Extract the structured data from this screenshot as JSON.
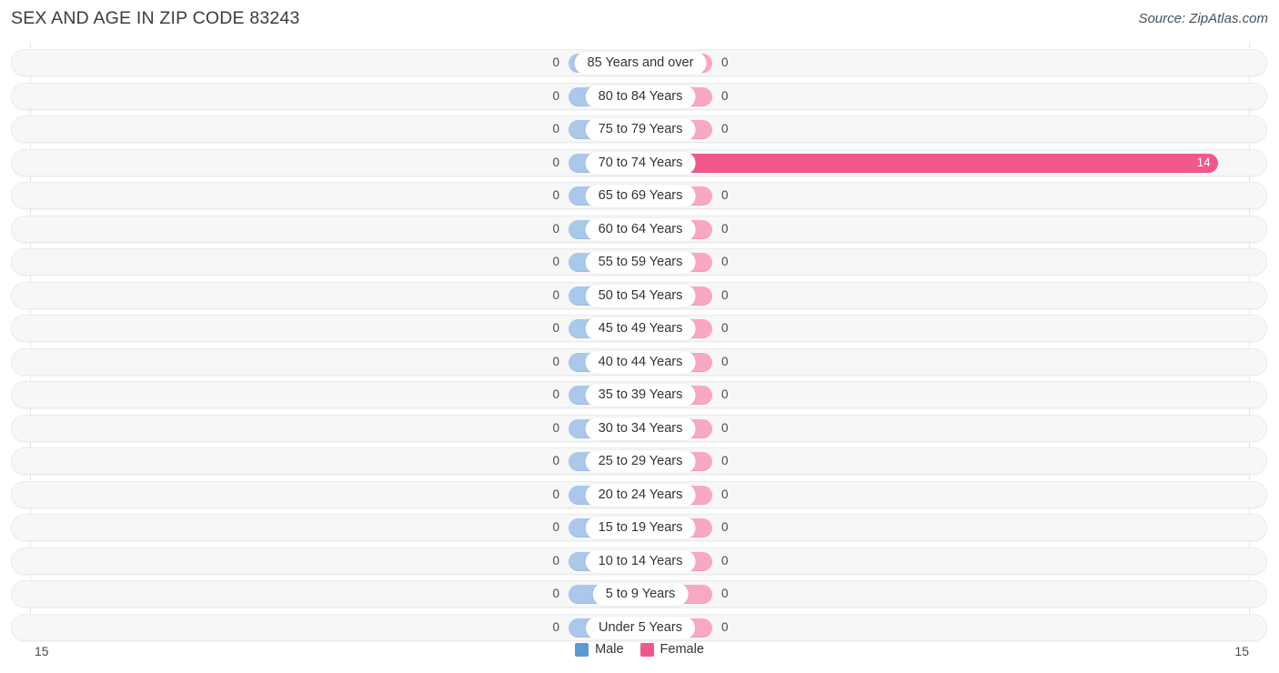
{
  "header": {
    "title": "SEX AND AGE IN ZIP CODE 83243",
    "source": "Source: ZipAtlas.com"
  },
  "legend": {
    "items": [
      {
        "label": "Male",
        "color": "#5b9bd5"
      },
      {
        "label": "Female",
        "color": "#f2578c"
      }
    ]
  },
  "axis": {
    "left_label": "15",
    "right_label": "15"
  },
  "colors": {
    "male_bar": "#a9c8eb",
    "female_bar": "#f9a8c4",
    "male_highlight": "#5b9bd5",
    "female_highlight": "#f2578c",
    "row_background": "#f7f7f7",
    "gridline": "#e6e6e6"
  },
  "chart_data": {
    "type": "bar",
    "title": "SEX AND AGE IN ZIP CODE 83243",
    "subtitle": "Source: ZipAtlas.com",
    "orientation": "horizontal-diverging",
    "xlabel": "",
    "ylabel": "",
    "xlim": [
      15,
      15
    ],
    "grid": true,
    "legend_position": "bottom-center",
    "categories": [
      "85 Years and over",
      "80 to 84 Years",
      "75 to 79 Years",
      "70 to 74 Years",
      "65 to 69 Years",
      "60 to 64 Years",
      "55 to 59 Years",
      "50 to 54 Years",
      "45 to 49 Years",
      "40 to 44 Years",
      "35 to 39 Years",
      "30 to 34 Years",
      "25 to 29 Years",
      "20 to 24 Years",
      "15 to 19 Years",
      "10 to 14 Years",
      "5 to 9 Years",
      "Under 5 Years"
    ],
    "series": [
      {
        "name": "Male",
        "values": [
          0,
          0,
          0,
          0,
          0,
          0,
          0,
          0,
          0,
          0,
          0,
          0,
          0,
          0,
          0,
          0,
          0,
          0
        ]
      },
      {
        "name": "Female",
        "values": [
          0,
          0,
          0,
          14,
          0,
          0,
          0,
          0,
          0,
          0,
          0,
          0,
          0,
          0,
          0,
          0,
          0,
          0
        ]
      }
    ]
  },
  "rows": [
    {
      "label": "85 Years and over",
      "male": "0",
      "female": "0"
    },
    {
      "label": "80 to 84 Years",
      "male": "0",
      "female": "0"
    },
    {
      "label": "75 to 79 Years",
      "male": "0",
      "female": "0"
    },
    {
      "label": "70 to 74 Years",
      "male": "0",
      "female": "14"
    },
    {
      "label": "65 to 69 Years",
      "male": "0",
      "female": "0"
    },
    {
      "label": "60 to 64 Years",
      "male": "0",
      "female": "0"
    },
    {
      "label": "55 to 59 Years",
      "male": "0",
      "female": "0"
    },
    {
      "label": "50 to 54 Years",
      "male": "0",
      "female": "0"
    },
    {
      "label": "45 to 49 Years",
      "male": "0",
      "female": "0"
    },
    {
      "label": "40 to 44 Years",
      "male": "0",
      "female": "0"
    },
    {
      "label": "35 to 39 Years",
      "male": "0",
      "female": "0"
    },
    {
      "label": "30 to 34 Years",
      "male": "0",
      "female": "0"
    },
    {
      "label": "25 to 29 Years",
      "male": "0",
      "female": "0"
    },
    {
      "label": "20 to 24 Years",
      "male": "0",
      "female": "0"
    },
    {
      "label": "15 to 19 Years",
      "male": "0",
      "female": "0"
    },
    {
      "label": "10 to 14 Years",
      "male": "0",
      "female": "0"
    },
    {
      "label": "5 to 9 Years",
      "male": "0",
      "female": "0"
    },
    {
      "label": "Under 5 Years",
      "male": "0",
      "female": "0"
    }
  ]
}
